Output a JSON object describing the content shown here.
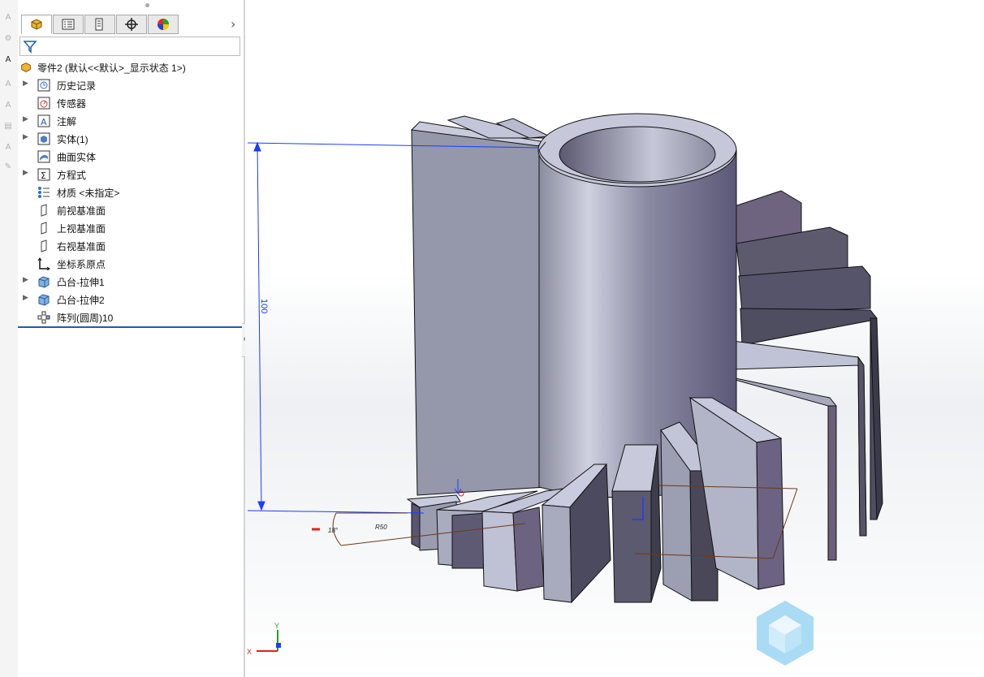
{
  "left_toolbar": {
    "icons": [
      "text-annotation-icon",
      "text-style-icon",
      "auto-balloon-icon",
      "note-icon",
      "stack-icon",
      "datum-icon",
      "weld-icon"
    ]
  },
  "feature_tabs": [
    {
      "name": "featuremanager-tab",
      "active": true
    },
    {
      "name": "propertymanager-tab",
      "active": false
    },
    {
      "name": "configurationmanager-tab",
      "active": false
    },
    {
      "name": "dimxpert-tab",
      "active": false
    },
    {
      "name": "displaymanager-tab",
      "active": false
    }
  ],
  "tree": {
    "root_label": "零件2  (默认<<默认>_显示状态 1>)",
    "items": [
      {
        "label": "历史记录",
        "icon": "history-icon",
        "expandable": true
      },
      {
        "label": "传感器",
        "icon": "sensor-icon",
        "expandable": false
      },
      {
        "label": "注解",
        "icon": "annotation-icon",
        "expandable": true
      },
      {
        "label": "实体(1)",
        "icon": "solid-body-icon",
        "expandable": true
      },
      {
        "label": "曲面实体",
        "icon": "surface-body-icon",
        "expandable": false
      },
      {
        "label": "方程式",
        "icon": "equation-icon",
        "expandable": true
      },
      {
        "label": "材质 <未指定>",
        "icon": "material-icon",
        "expandable": false
      },
      {
        "label": "前视基准面",
        "icon": "plane-icon",
        "expandable": false
      },
      {
        "label": "上视基准面",
        "icon": "plane-icon",
        "expandable": false
      },
      {
        "label": "右视基准面",
        "icon": "plane-icon",
        "expandable": false
      },
      {
        "label": "坐标系原点",
        "icon": "origin-icon",
        "expandable": false
      },
      {
        "label": "凸台-拉伸1",
        "icon": "extrude-icon",
        "expandable": true
      },
      {
        "label": "凸台-拉伸2",
        "icon": "extrude-icon",
        "expandable": true
      },
      {
        "label": "阵列(圆周)10",
        "icon": "circular-pattern-icon",
        "expandable": false
      }
    ]
  },
  "viewport": {
    "dimension_height": "100",
    "dimension_angle": "18°",
    "dimension_radius": "R50",
    "axis_x": "X",
    "axis_y": "Y",
    "colors": {
      "dimension": "#1a3cff",
      "sketch": "#6b3a1a",
      "body": "#9aa0b4",
      "face_light": "#c9cce0",
      "face_dark": "#5a5670"
    }
  }
}
